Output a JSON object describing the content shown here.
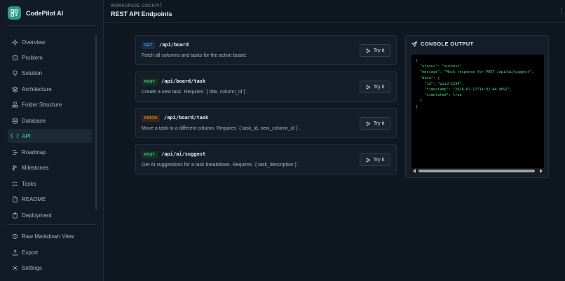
{
  "app": {
    "name": "CodePilot AI"
  },
  "header": {
    "eyebrow": "WORKSPACE COCKPIT",
    "title": "REST API Endpoints"
  },
  "sidebar": {
    "items": [
      {
        "label": "Overview",
        "icon": "sparkles-icon"
      },
      {
        "label": "Problem",
        "icon": "alert-icon"
      },
      {
        "label": "Solution",
        "icon": "lightbulb-icon"
      },
      {
        "label": "Architecture",
        "icon": "layers-icon"
      },
      {
        "label": "Folder Structure",
        "icon": "folder-tree-icon"
      },
      {
        "label": "Database",
        "icon": "database-icon"
      },
      {
        "label": "API",
        "icon": "braces-icon",
        "active": true
      },
      {
        "label": "Roadmap",
        "icon": "roadmap-icon"
      },
      {
        "label": "Milestones",
        "icon": "milestone-icon"
      },
      {
        "label": "Tasks",
        "icon": "list-check-icon"
      },
      {
        "label": "README",
        "icon": "file-icon"
      },
      {
        "label": "Deployment",
        "icon": "clipboard-icon"
      }
    ],
    "footer_items": [
      {
        "label": "Raw Markdown View",
        "icon": "history-icon"
      },
      {
        "label": "Export",
        "icon": "export-icon"
      },
      {
        "label": "Settings",
        "icon": "gear-icon"
      }
    ]
  },
  "endpoints": [
    {
      "method": "GET",
      "path": "/api/board",
      "description": "Fetch all columns and tasks for the active board.",
      "button": "Try it"
    },
    {
      "method": "POST",
      "path": "/api/board/task",
      "description": "Create a new task. Requires `{ title, column_id }`.",
      "button": "Try it"
    },
    {
      "method": "PATCH",
      "path": "/api/board/task",
      "description": "Move a task to a different column. Requires `{ task_id, new_column_id }`.",
      "button": "Try it"
    },
    {
      "method": "POST",
      "path": "/api/ai/suggest",
      "description": "Get AI suggestions for a task breakdown. Requires `{ task_description }`.",
      "button": "Try it"
    }
  ],
  "console": {
    "title": "CONSOLE OUTPUT",
    "output": "{\n  \"status\": \"success\",\n  \"message\": \"Mock response for POST /api/ai/suggest\",\n  \"data\": {\n    \"id\": \"uuid-1234\",\n    \"timestamp\": \"2026-07-17T14:02:44.969Z\",\n    \"simulated\": true\n  }\n}"
  },
  "colors": {
    "accent": "#4fd1b5",
    "console_text": "#4ade80",
    "get": "#5aa9ee",
    "post": "#55c98a",
    "patch": "#e59a4c"
  }
}
